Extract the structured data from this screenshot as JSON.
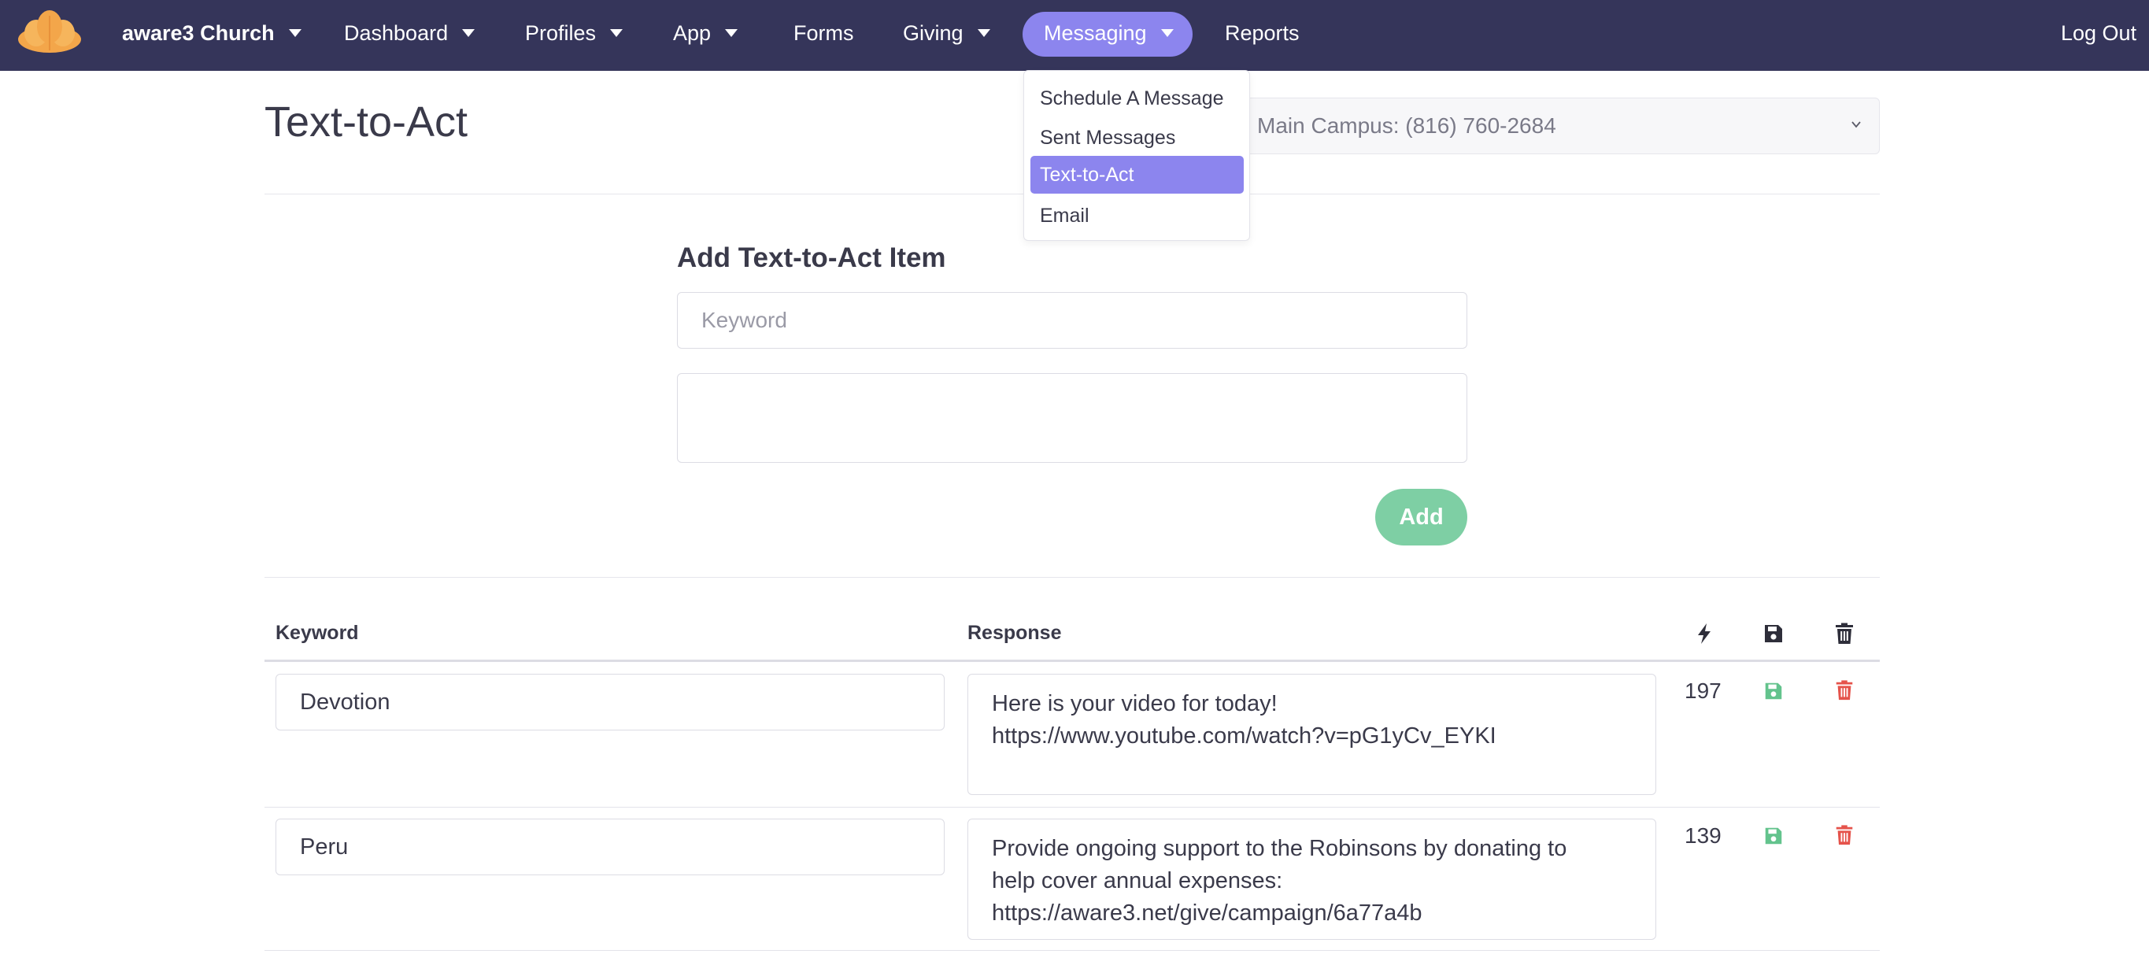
{
  "nav": {
    "brand": "aware3 Church",
    "dashboard": "Dashboard",
    "profiles": "Profiles",
    "app": "App",
    "forms": "Forms",
    "giving": "Giving",
    "messaging": "Messaging",
    "reports": "Reports",
    "logout": "Log Out"
  },
  "dropdown": {
    "items": [
      "Schedule A Message",
      "Sent Messages",
      "Text-to-Act",
      "Email"
    ],
    "selected": "Text-to-Act"
  },
  "page": {
    "title": "Text-to-Act",
    "campus_select": "Main Campus: (816) 760-2684"
  },
  "form": {
    "title": "Add Text-to-Act Item",
    "keyword_placeholder": "Keyword",
    "response_value": "",
    "add_label": "Add"
  },
  "table": {
    "headers": {
      "keyword": "Keyword",
      "response": "Response"
    },
    "header_icons": [
      "bolt-icon",
      "save-icon",
      "trash-icon"
    ],
    "rows": [
      {
        "keyword": "Devotion",
        "response": "Here is your video for today!\nhttps://www.youtube.com/watch?v=pG1yCv_EYKI",
        "count": "197"
      },
      {
        "keyword": "Peru",
        "response": "Provide ongoing support to the Robinsons by donating to\nhelp cover annual expenses:\nhttps://aware3.net/give/campaign/6a77a4b",
        "count": "139"
      }
    ]
  },
  "colors": {
    "navbar": "#35355a",
    "accent": "#8c85ee",
    "success": "#7ecfa4",
    "save_icon": "#63c38d",
    "danger": "#e5534b",
    "logo": "#f3a64a"
  }
}
